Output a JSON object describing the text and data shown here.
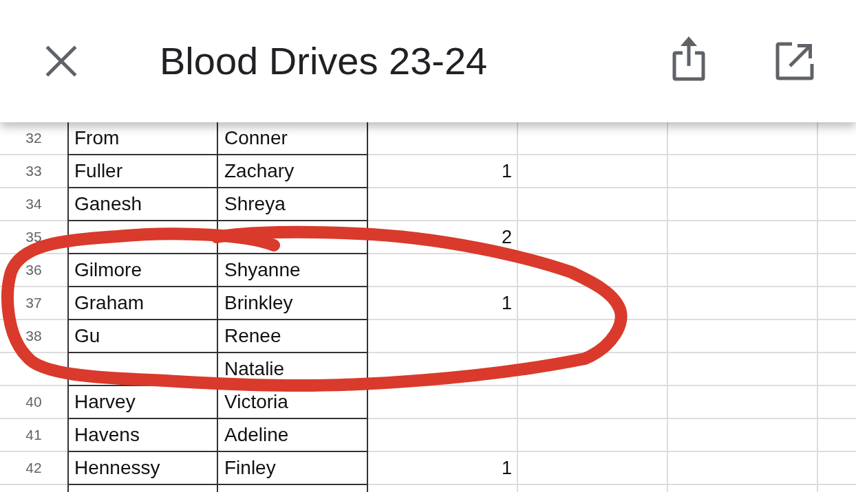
{
  "header": {
    "title": "Blood Drives 23-24"
  },
  "sheet": {
    "rows": [
      {
        "row_number": "32",
        "column_a": "From",
        "column_b": "Conner"
      },
      {
        "row_number": "33",
        "column_a": "Fuller",
        "column_b": "Zachary",
        "column_c": "1"
      },
      {
        "row_number": "34",
        "column_a": "Ganesh",
        "column_b": "Shreya"
      },
      {
        "row_number": "35",
        "column_c": "2"
      },
      {
        "row_number": "36",
        "column_a": "Gilmore",
        "column_b": "Shyanne"
      },
      {
        "row_number": "37",
        "column_a": "Graham",
        "column_b": "Brinkley",
        "column_c": "1"
      },
      {
        "row_number": "38",
        "column_a": "Gu",
        "column_b": "Renee"
      },
      {
        "column_b": "Natalie"
      },
      {
        "row_number": "40",
        "column_a": "Harvey",
        "column_b": "Victoria"
      },
      {
        "row_number": "41",
        "column_a": "Havens",
        "column_b": "Adeline"
      },
      {
        "row_number": "42",
        "column_a": "Hennessy",
        "column_b": "Finley",
        "column_c": "1"
      }
    ]
  },
  "annotations": [
    {
      "kind": "loop"
    }
  ]
}
